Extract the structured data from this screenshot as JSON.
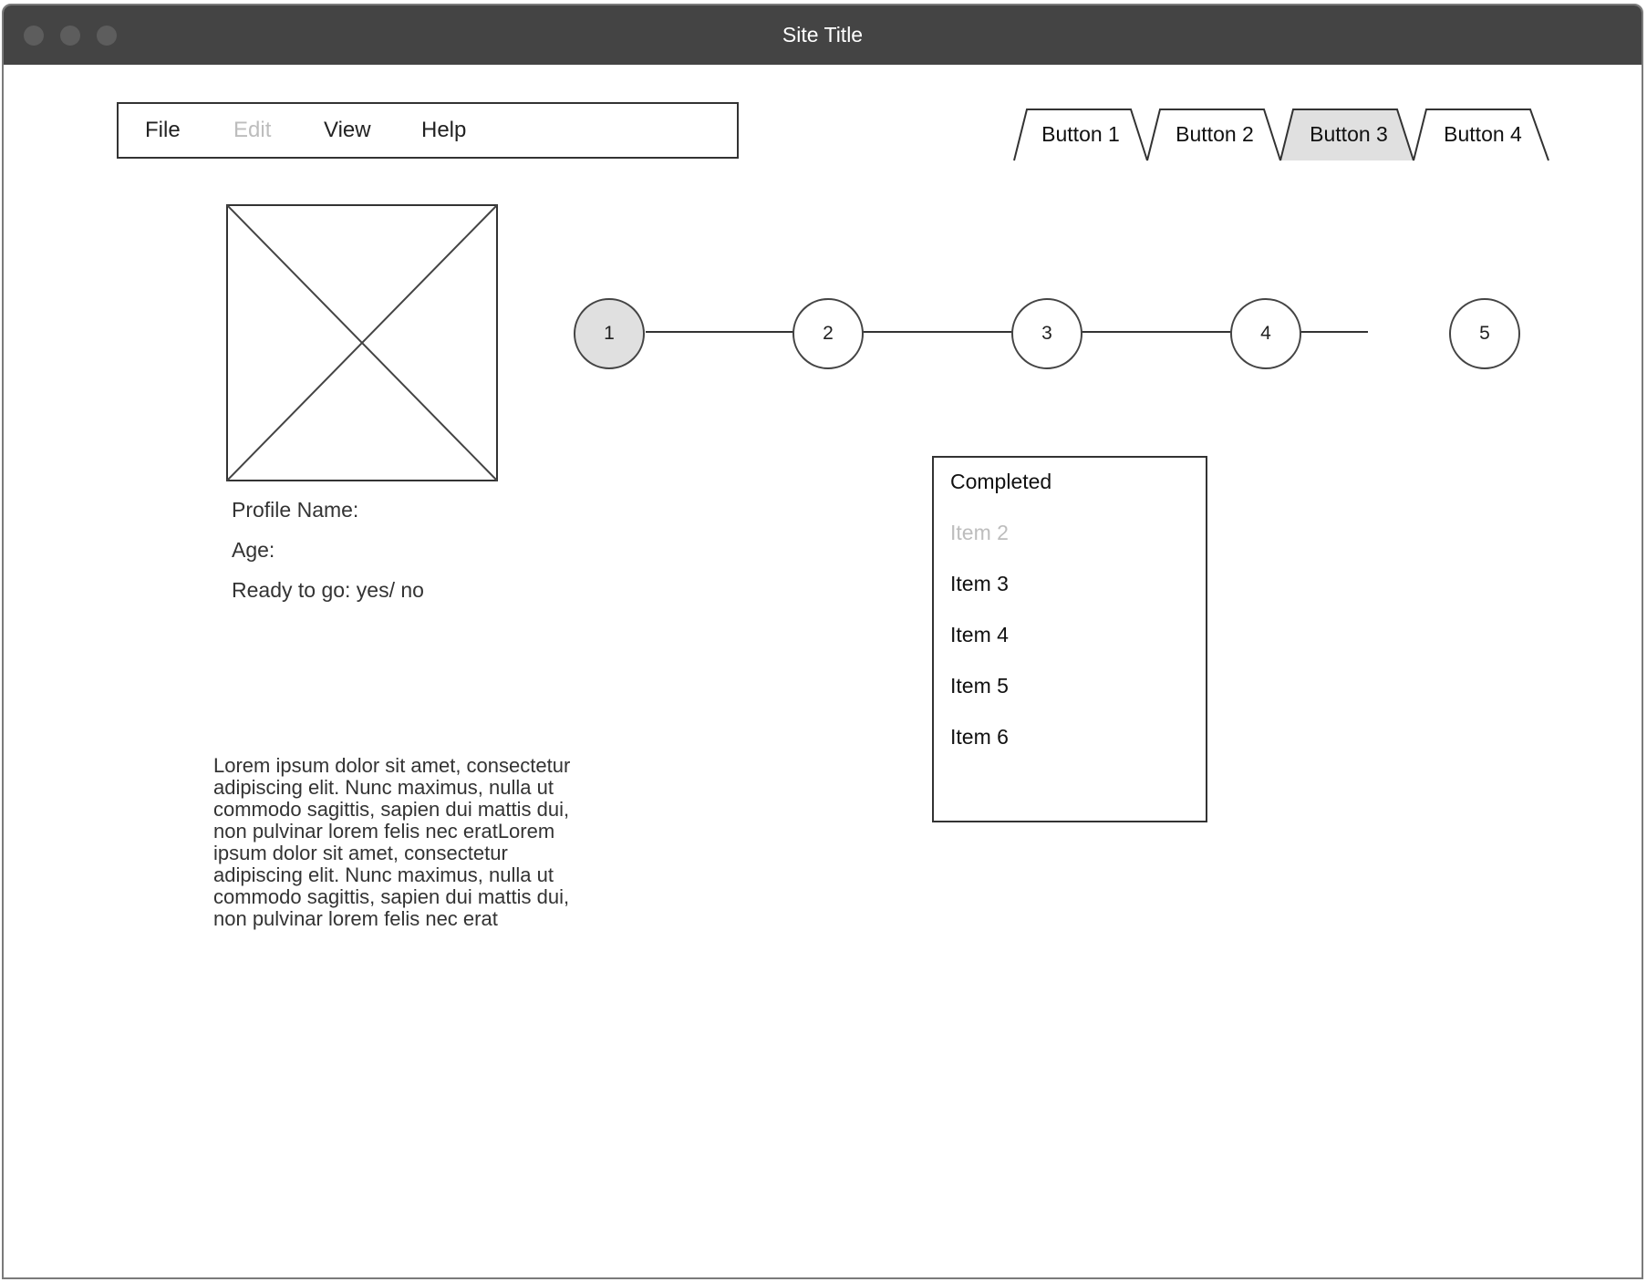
{
  "window": {
    "title": "Site Title"
  },
  "menubar": {
    "items": [
      {
        "label": "File",
        "disabled": false
      },
      {
        "label": "Edit",
        "disabled": true
      },
      {
        "label": "View",
        "disabled": false
      },
      {
        "label": "Help",
        "disabled": false
      }
    ]
  },
  "tabs": {
    "items": [
      {
        "label": "Button 1",
        "selected": false
      },
      {
        "label": "Button 2",
        "selected": false
      },
      {
        "label": "Button 3",
        "selected": true
      },
      {
        "label": "Button 4",
        "selected": false
      }
    ]
  },
  "profile": {
    "name_label": "Profile Name:",
    "age_label": "Age:",
    "ready_label": "Ready to go: yes/ no"
  },
  "steps": {
    "items": [
      "1",
      "2",
      "3",
      "4",
      "5"
    ],
    "active_index": 0
  },
  "list": {
    "items": [
      {
        "label": "Completed",
        "disabled": false
      },
      {
        "label": "Item 2",
        "disabled": true
      },
      {
        "label": "Item 3",
        "disabled": false
      },
      {
        "label": "Item 4",
        "disabled": false
      },
      {
        "label": "Item 5",
        "disabled": false
      },
      {
        "label": "Item 6",
        "disabled": false
      }
    ]
  },
  "body_text": "Lorem ipsum dolor sit amet, consectetur adipiscing elit. Nunc maximus, nulla ut commodo sagittis, sapien dui mattis dui, non pulvinar lorem felis nec eratLorem ipsum dolor sit amet, consectetur adipiscing elit. Nunc maximus, nulla ut commodo sagittis, sapien dui mattis dui, non pulvinar lorem felis nec erat",
  "colors": {
    "titlebar": "#444444",
    "selected_fill": "#e0e0e0",
    "disabled_text": "#bdbdbd",
    "border": "#333333"
  }
}
